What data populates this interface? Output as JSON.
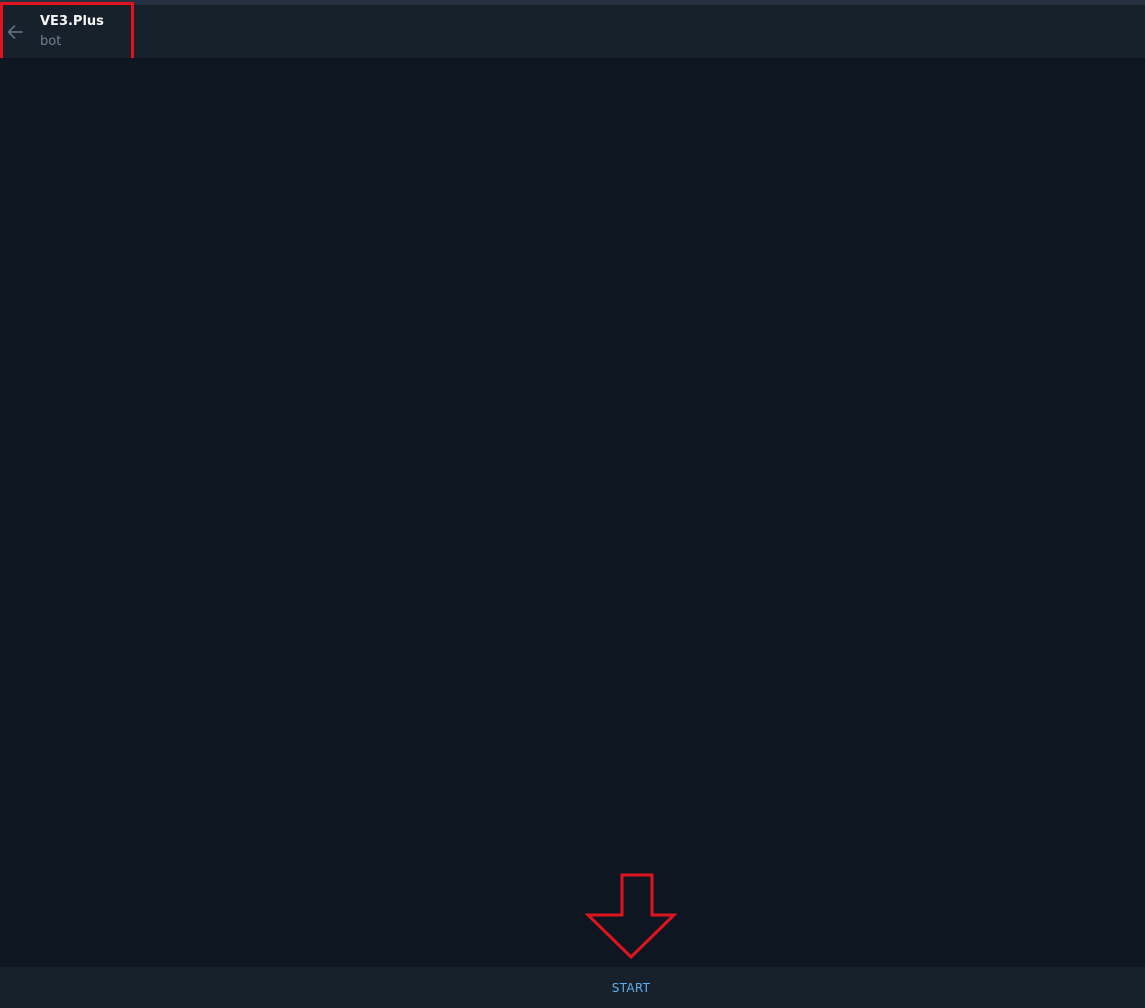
{
  "header": {
    "title": "VE3.Plus",
    "subtitle": "bot",
    "back_icon": "arrow-left-icon"
  },
  "footer": {
    "start_label": "START"
  },
  "annotations": {
    "highlight_color": "#e0141e",
    "arrow_icon": "arrow-down-outline-icon"
  },
  "colors": {
    "background": "#0e1621",
    "header_background": "#17212b",
    "accent": "#5eaee6",
    "title_text": "#f5f5f5",
    "subtitle_text": "#6d7f8f"
  }
}
